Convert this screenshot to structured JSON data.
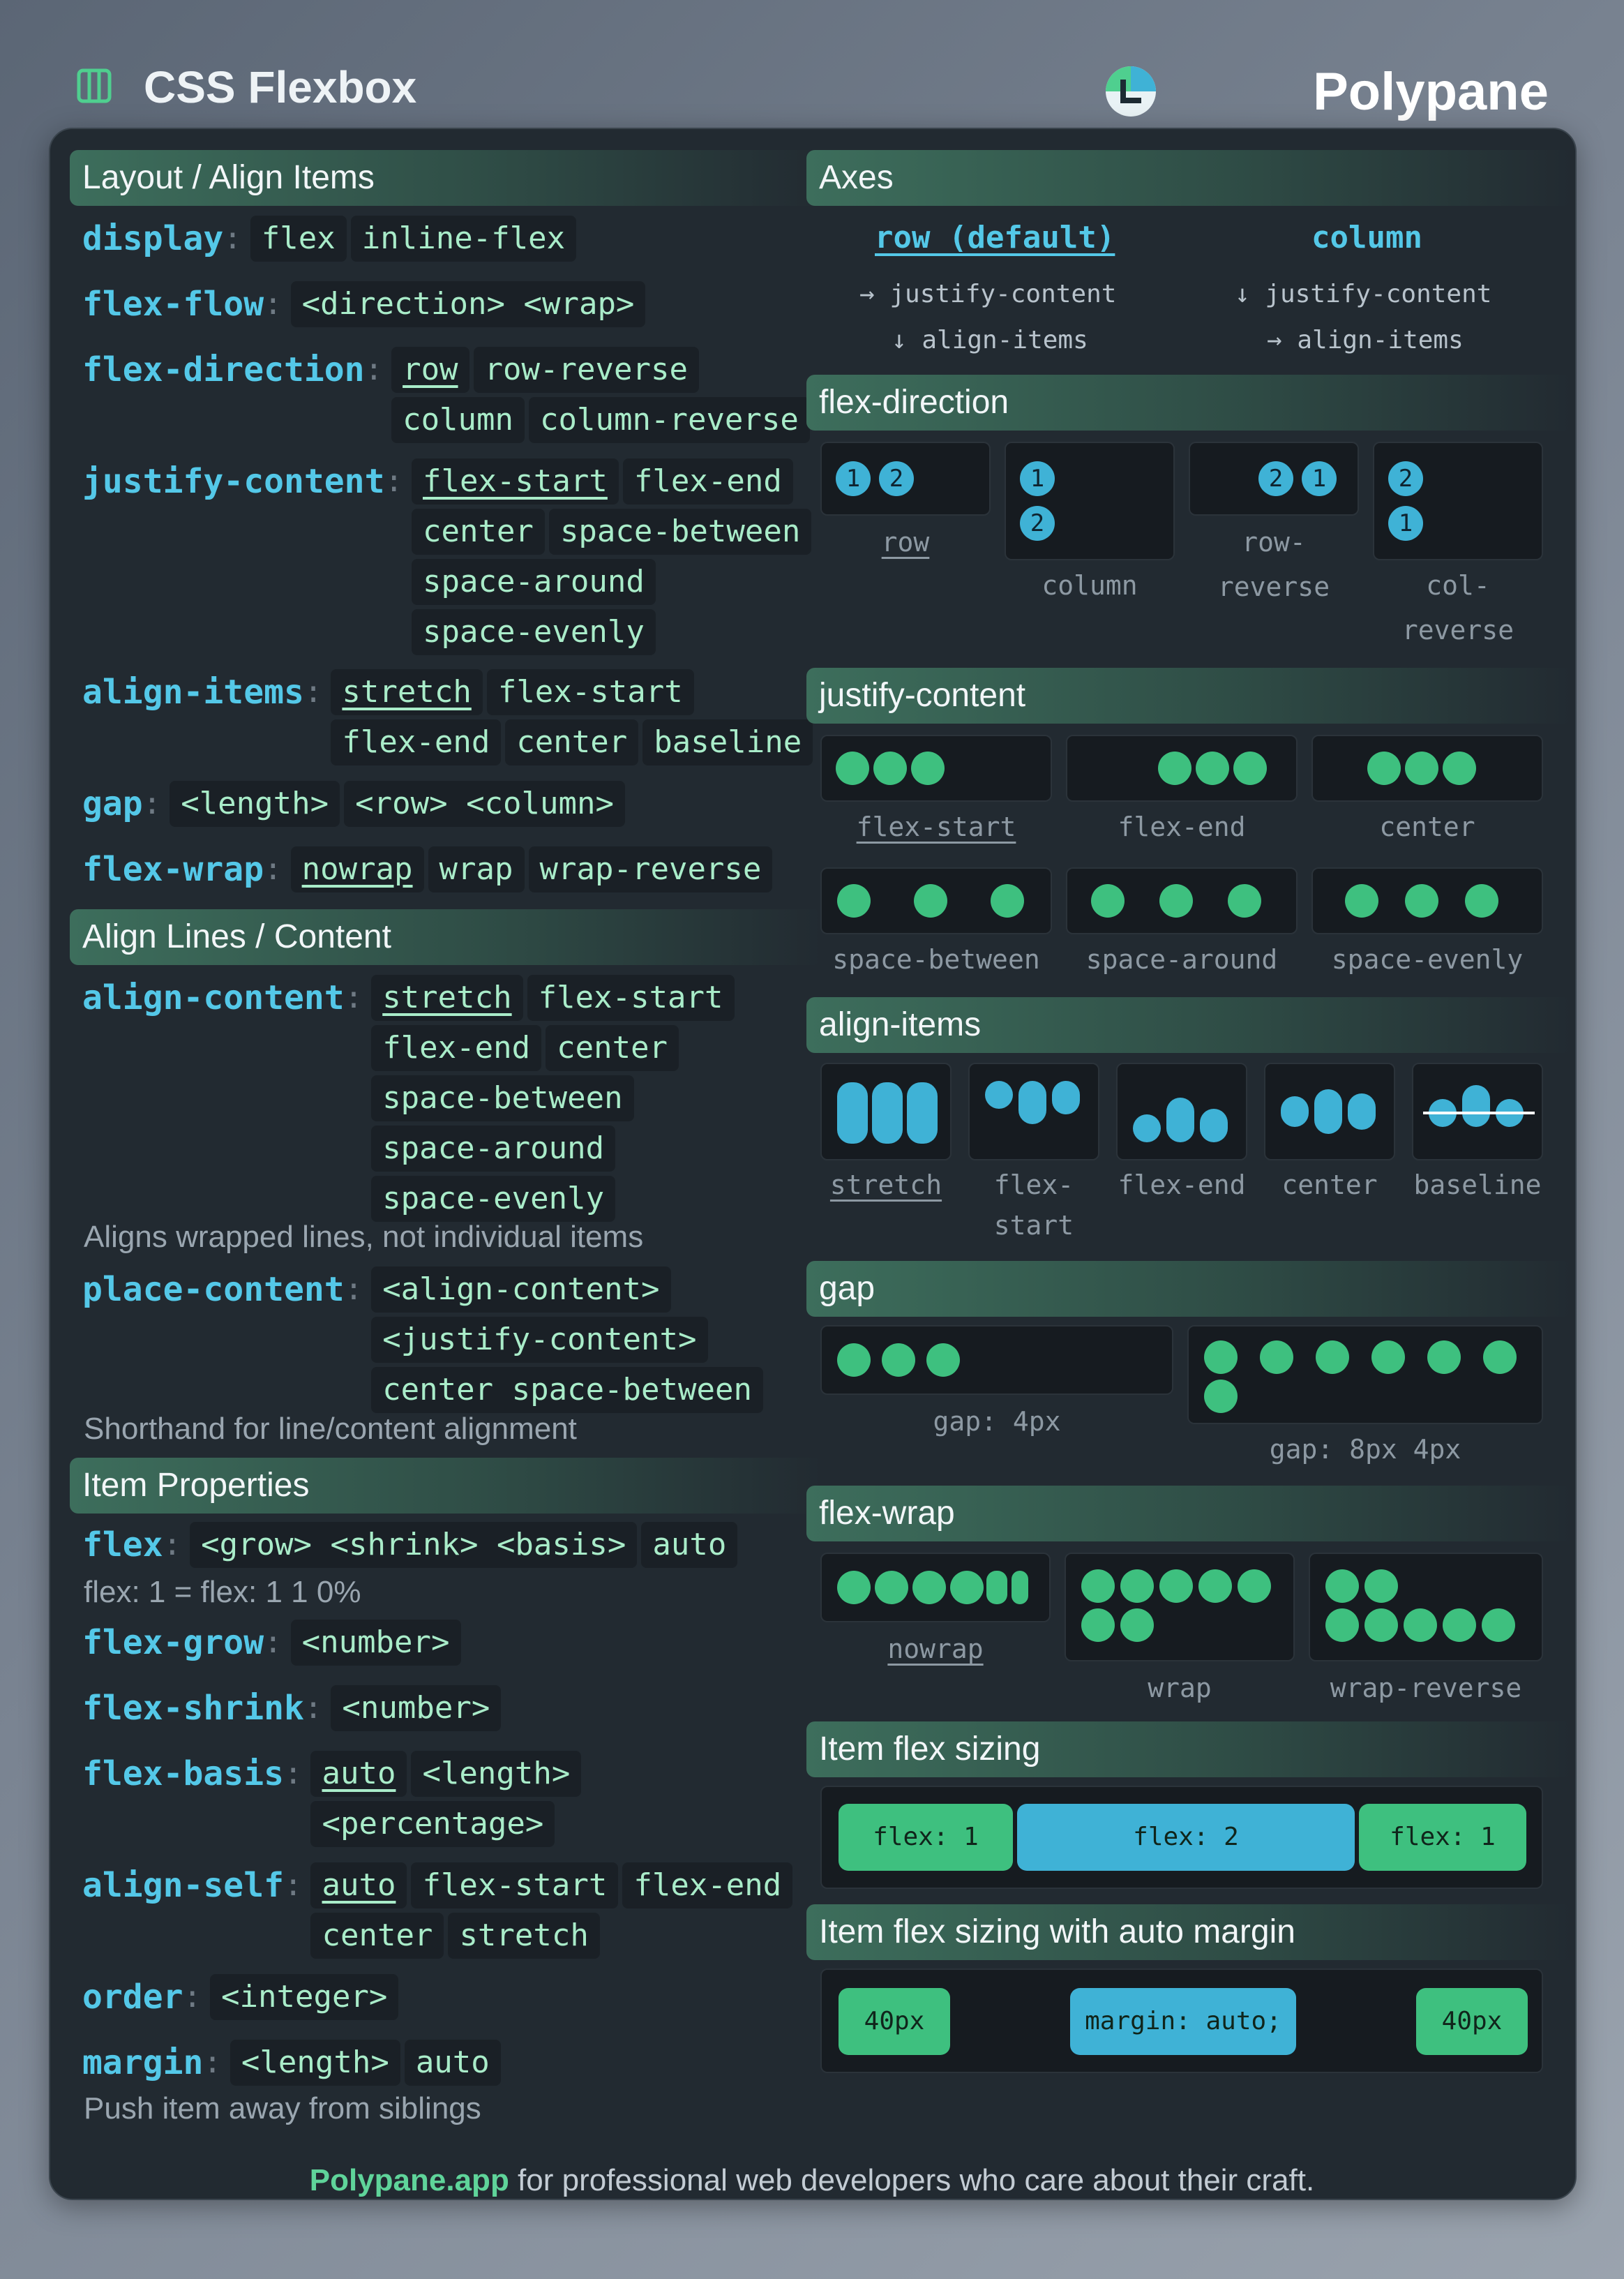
{
  "header": {
    "title": "CSS Flexbox",
    "brand": "Polypane"
  },
  "sections": {
    "layout": "Layout / Align Items",
    "lines": "Align Lines / Content",
    "items": "Item Properties",
    "axes": "Axes",
    "flex_direction": "flex-direction",
    "justify_content": "justify-content",
    "align_items": "align-items",
    "gap": "gap",
    "flex_wrap": "flex-wrap",
    "flex_sizing": "Item flex sizing",
    "flex_sizing_margin": "Item flex sizing with auto margin"
  },
  "layout_props": [
    {
      "name": "display",
      "values": [
        "flex",
        "inline-flex"
      ],
      "default": -1
    },
    {
      "name": "flex-flow",
      "values": [
        "<direction> <wrap>"
      ],
      "default": -1
    },
    {
      "name": "flex-direction",
      "values": [
        "row",
        "row-reverse",
        "column",
        "column-reverse"
      ],
      "default": 0
    },
    {
      "name": "justify-content",
      "values": [
        "flex-start",
        "flex-end",
        "center",
        "space-between",
        "space-around",
        "space-evenly"
      ],
      "default": 0
    },
    {
      "name": "align-items",
      "values": [
        "stretch",
        "flex-start",
        "flex-end",
        "center",
        "baseline"
      ],
      "default": 0
    },
    {
      "name": "gap",
      "values": [
        "<length>",
        "<row> <column>"
      ],
      "default": -1
    },
    {
      "name": "flex-wrap",
      "values": [
        "nowrap",
        "wrap",
        "wrap-reverse"
      ],
      "default": 0
    }
  ],
  "lines_props": [
    {
      "name": "align-content",
      "values": [
        "stretch",
        "flex-start",
        "flex-end",
        "center",
        "space-between",
        "space-around",
        "space-evenly"
      ],
      "default": 0
    },
    {
      "name": "place-content",
      "values": [
        "<align-content>",
        "<justify-content>",
        "center space-between"
      ],
      "default": -1
    }
  ],
  "notes": {
    "align_content": "Aligns wrapped lines, not individual items",
    "place_content": "Shorthand for line/content alignment",
    "flex": "flex: 1 = flex: 1 1 0%",
    "margin": "Push item away from siblings"
  },
  "item_props": [
    {
      "name": "flex",
      "values": [
        "<grow> <shrink> <basis>",
        "auto"
      ],
      "default": -1
    },
    {
      "name": "flex-grow",
      "values": [
        "<number>"
      ],
      "default": -1
    },
    {
      "name": "flex-shrink",
      "values": [
        "<number>"
      ],
      "default": -1
    },
    {
      "name": "flex-basis",
      "values": [
        "auto",
        "<length>",
        "<percentage>"
      ],
      "default": 0
    },
    {
      "name": "align-self",
      "values": [
        "auto",
        "flex-start",
        "flex-end",
        "center",
        "stretch"
      ],
      "default": 0
    },
    {
      "name": "order",
      "values": [
        "<integer>"
      ],
      "default": -1
    },
    {
      "name": "margin",
      "values": [
        "<length>",
        "auto"
      ],
      "default": -1
    }
  ],
  "axes": {
    "row": {
      "title": "row (default)",
      "line1": "→ justify-content",
      "line2": "↓ align-items"
    },
    "column": {
      "title": "column",
      "line1": "↓ justify-content",
      "line2": "→ align-items"
    }
  },
  "flex_direction_caps": [
    "row",
    "column",
    "row-\nreverse",
    "col-\nreverse"
  ],
  "justify_caps": [
    "flex-start",
    "flex-end",
    "center",
    "space-between",
    "space-around",
    "space-evenly"
  ],
  "align_caps": [
    "stretch",
    "flex-\nstart",
    "flex-end",
    "center",
    "baseline"
  ],
  "gap_caps": [
    "gap: 4px",
    "gap: 8px 4px"
  ],
  "wrap_caps": [
    "nowrap",
    "wrap",
    "wrap-reverse"
  ],
  "flex_sizing": [
    "flex: 1",
    "flex: 2",
    "flex: 1"
  ],
  "flex_margin": [
    "40px",
    "margin: auto;",
    "40px"
  ],
  "numbers": {
    "one": "1",
    "two": "2"
  },
  "footer": {
    "brand": "Polypane.app",
    "text": " for professional web developers who care about their craft."
  },
  "colors": {
    "accent_blue": "#54c8e8",
    "value_green": "#a9ecc9",
    "dot_green": "#3ec07f",
    "item_blue": "#3fb2d6",
    "card": "#222a31"
  }
}
